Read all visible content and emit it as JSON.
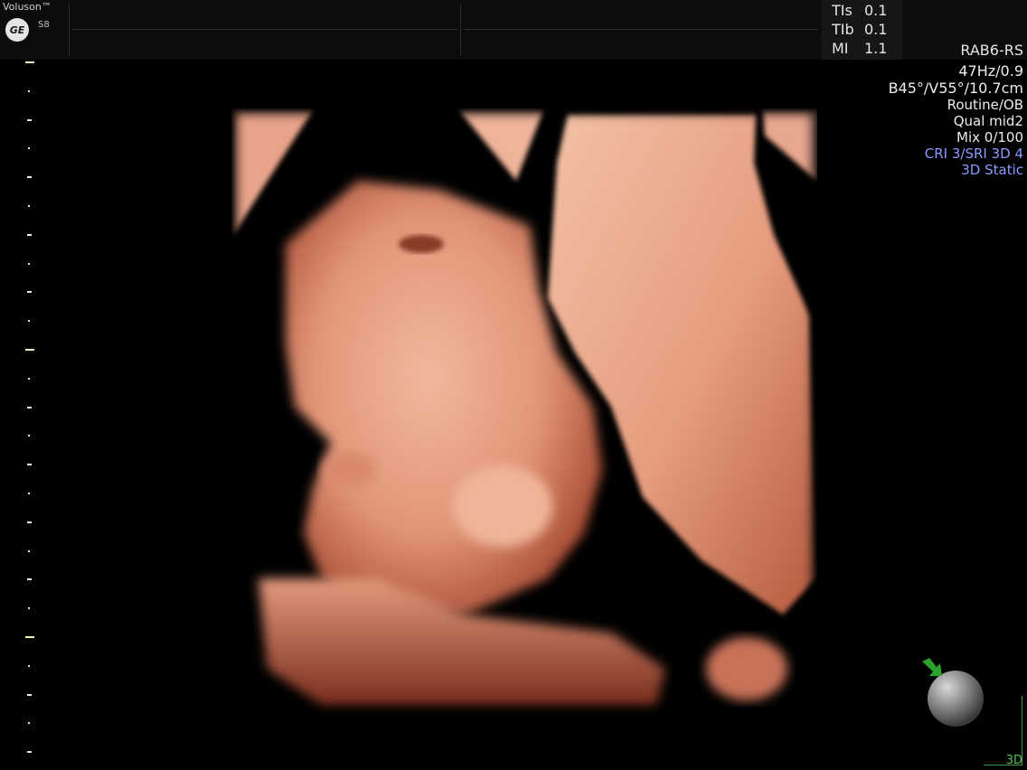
{
  "header": {
    "brand": "Voluson™",
    "logo_text": "GE",
    "model": "S8",
    "indices": [
      {
        "label": "TIs",
        "value": "0.1"
      },
      {
        "label": "TIb",
        "value": "0.1"
      },
      {
        "label": "MI",
        "value": "1.1"
      }
    ],
    "probe": "RAB6-RS"
  },
  "info": {
    "frame_rate": "47Hz/0.9",
    "angles": "B45°/V55°/10.7cm",
    "preset": "Routine/OB",
    "quality": "Qual mid2",
    "mix": "Mix 0/100",
    "filters": "CRI 3/SRI 3D 4",
    "render_mode": "3D Static"
  },
  "colors": {
    "background": "#000000",
    "accent_blue": "#8c9bff",
    "accent_green": "#52c152",
    "skin": "#e39a7c"
  },
  "icons": {
    "logo": "ge-logo-icon",
    "orientation": "orientation-sphere-icon",
    "arrow": "green-arrow-icon"
  },
  "footer": {
    "mode": "3D"
  }
}
